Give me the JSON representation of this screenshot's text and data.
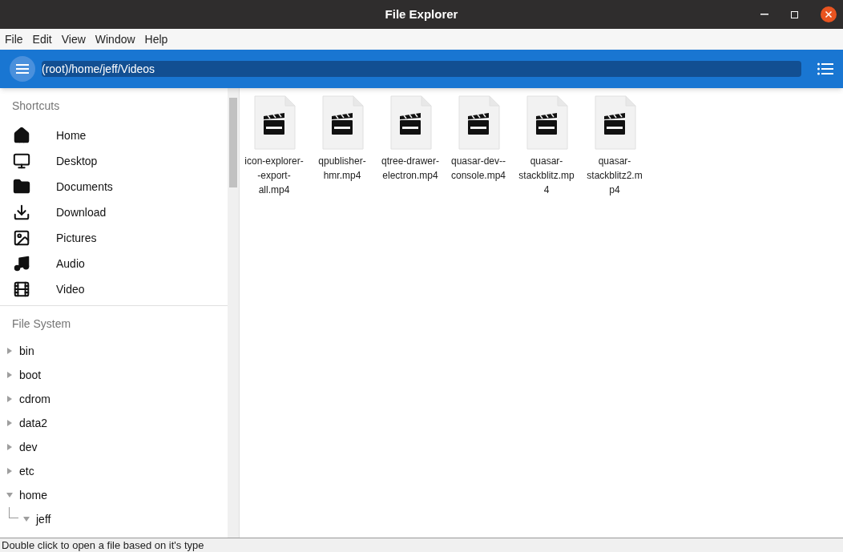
{
  "window": {
    "title": "File Explorer"
  },
  "menu": [
    "File",
    "Edit",
    "View",
    "Window",
    "Help"
  ],
  "toolbar": {
    "path": "(root)/home/jeff/Videos"
  },
  "shortcuts": {
    "heading": "Shortcuts",
    "items": [
      {
        "label": "Home",
        "kind": "home"
      },
      {
        "label": "Desktop",
        "kind": "desktop"
      },
      {
        "label": "Documents",
        "kind": "documents"
      },
      {
        "label": "Download",
        "kind": "download"
      },
      {
        "label": "Pictures",
        "kind": "pictures"
      },
      {
        "label": "Audio",
        "kind": "audio"
      },
      {
        "label": "Video",
        "kind": "video"
      }
    ]
  },
  "file_system": {
    "heading": "File System",
    "tree": [
      {
        "label": "bin",
        "expanded": false
      },
      {
        "label": "boot",
        "expanded": false
      },
      {
        "label": "cdrom",
        "expanded": false
      },
      {
        "label": "data2",
        "expanded": false
      },
      {
        "label": "dev",
        "expanded": false
      },
      {
        "label": "etc",
        "expanded": false
      },
      {
        "label": "home",
        "expanded": true,
        "children": [
          {
            "label": "jeff",
            "expanded": true
          }
        ]
      }
    ]
  },
  "files": [
    {
      "name": "icon-explorer--export-all.mp4"
    },
    {
      "name": "qpublisher-hmr.mp4"
    },
    {
      "name": "qtree-drawer-electron.mp4"
    },
    {
      "name": "quasar-dev--console.mp4"
    },
    {
      "name": "quasar-stackblitz.mp4"
    },
    {
      "name": "quasar-stackblitz2.mp4"
    }
  ],
  "status_bar": "Double click to open a file based on it's type"
}
